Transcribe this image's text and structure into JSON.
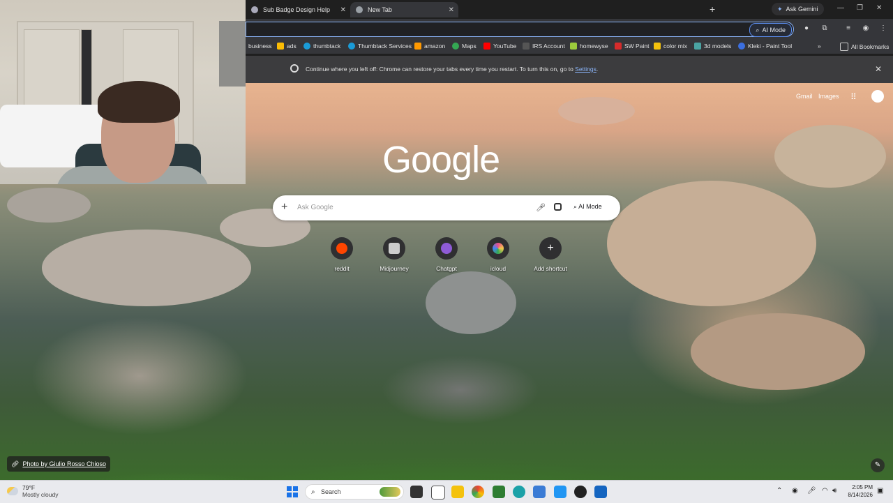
{
  "browser": {
    "tabs": [
      {
        "title": "Sub Badge Design Help",
        "active": false
      },
      {
        "title": "New Tab",
        "active": true
      }
    ],
    "ask_gemini_label": "Ask Gemini",
    "omnibox_ai_mode_label": "AI Mode",
    "bookmarks": [
      {
        "label": "business",
        "color": "#444"
      },
      {
        "label": "ads",
        "color": "#fbbc04"
      },
      {
        "label": "thumbtack",
        "color": "#1a9bd7"
      },
      {
        "label": "Thumbtack Services",
        "color": "#1a9bd7"
      },
      {
        "label": "amazon",
        "color": "#ff9900"
      },
      {
        "label": "Maps",
        "color": "#34a853"
      },
      {
        "label": "YouTube",
        "color": "#ff0000"
      },
      {
        "label": "IRS Account",
        "color": "#555"
      },
      {
        "label": "homewyse",
        "color": "#9ccc3c"
      },
      {
        "label": "SW Paint",
        "color": "#d62b2b"
      },
      {
        "label": "color mix",
        "color": "#f4c20d"
      },
      {
        "label": "3d models",
        "color": "#4aa3a2"
      },
      {
        "label": "Kleki - Paint Tool",
        "color": "#3b6fe0"
      }
    ],
    "all_bookmarks_label": "All Bookmarks",
    "infobar": {
      "message": "Continue where you left off: Chrome can restore your tabs every time you restart. To turn this on, go to ",
      "link": "Settings",
      "suffix": "."
    }
  },
  "ntp": {
    "gmail": "Gmail",
    "images": "Images",
    "logo": "Google",
    "search_placeholder": "Ask Google",
    "ai_mode_label": "AI Mode",
    "shortcuts": [
      {
        "label": "reddit",
        "color": "#ff4500"
      },
      {
        "label": "Midjourney",
        "color": "#cccccc"
      },
      {
        "label": "Chatgpt",
        "color": "#8e5bd6"
      },
      {
        "label": "icloud",
        "color": "#e94d8a"
      },
      {
        "label": "Add shortcut",
        "color": "#2f2f31"
      }
    ],
    "photo_credit": "Photo by Giulio Rosso Chioso"
  },
  "taskbar": {
    "temperature": "79°F",
    "weather": "Mostly cloudy",
    "search_label": "Search",
    "time": "2:05 PM",
    "date": "8/14/2026"
  }
}
